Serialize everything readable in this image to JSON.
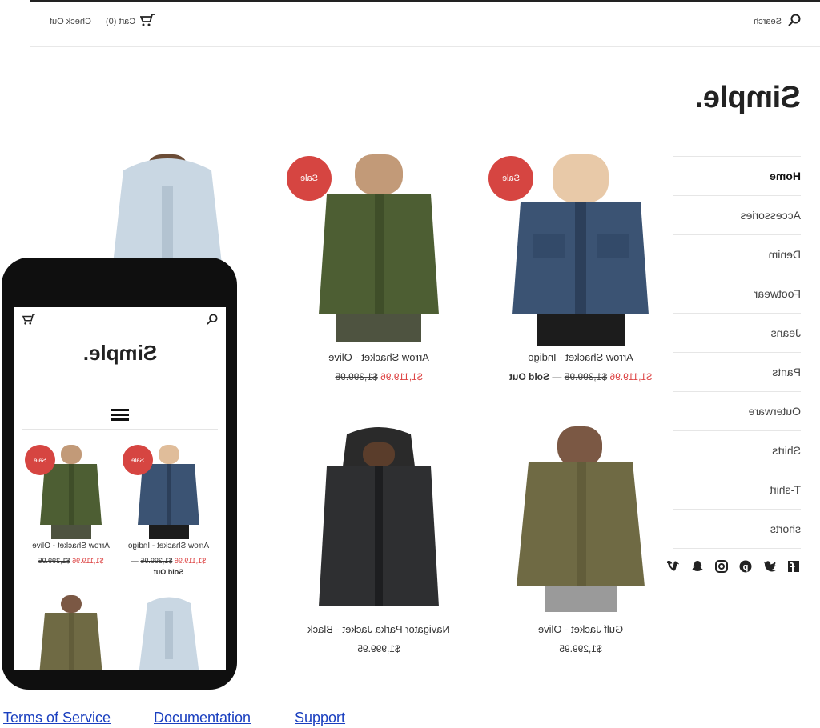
{
  "header": {
    "search_label": "Search",
    "cart_label": "Cart (0)",
    "checkout_label": "Check Out",
    "logo": "Simple."
  },
  "sidebar": {
    "items": [
      {
        "label": "Home"
      },
      {
        "label": "Accessories"
      },
      {
        "label": "Denim"
      },
      {
        "label": "Footwear"
      },
      {
        "label": "Jeans"
      },
      {
        "label": "Pants"
      },
      {
        "label": "Outerware"
      },
      {
        "label": "Shirts"
      },
      {
        "label": "T-shirt"
      },
      {
        "label": "shorts"
      }
    ],
    "social_icons": [
      "facebook-icon",
      "twitter-icon",
      "pinterest-icon",
      "instagram-icon",
      "snapchat-icon",
      "vimeo-icon"
    ]
  },
  "products": [
    {
      "name": "Arrow Shacket - Indigo",
      "sale_price": "$1,119.96",
      "orig_price": "$1,399.95",
      "sep": "—",
      "status": "Sold Out",
      "badge": "Sale"
    },
    {
      "name": "Arrow Shacket - Olive",
      "sale_price": "$1,119.96",
      "orig_price": "$1,399.95",
      "badge": "Sale"
    },
    {
      "name": "",
      "price": ""
    },
    {
      "name": "Gulf Jacket - Olive",
      "price": "$1,299.95"
    },
    {
      "name": "Navigator Parka Jacket - Black",
      "price": "$1,999.95"
    }
  ],
  "phone": {
    "logo": "Simple.",
    "products": [
      {
        "name": "Arrow Shacket - Indigo",
        "sale_price": "$1,119.96",
        "orig_price": "$1,399.95",
        "sep": "—",
        "status": "Sold Out",
        "badge": "Sale"
      },
      {
        "name": "Arrow Shacket - Olive",
        "sale_price": "$1,119.96",
        "orig_price": "$1,399.95",
        "badge": "Sale"
      }
    ]
  },
  "footer": {
    "links": [
      "Terms of Service",
      "Documentation",
      "Support"
    ]
  },
  "colors": {
    "sale_badge": "#d64541",
    "sale_price": "#dd4444",
    "link": "#1a3fbf"
  }
}
